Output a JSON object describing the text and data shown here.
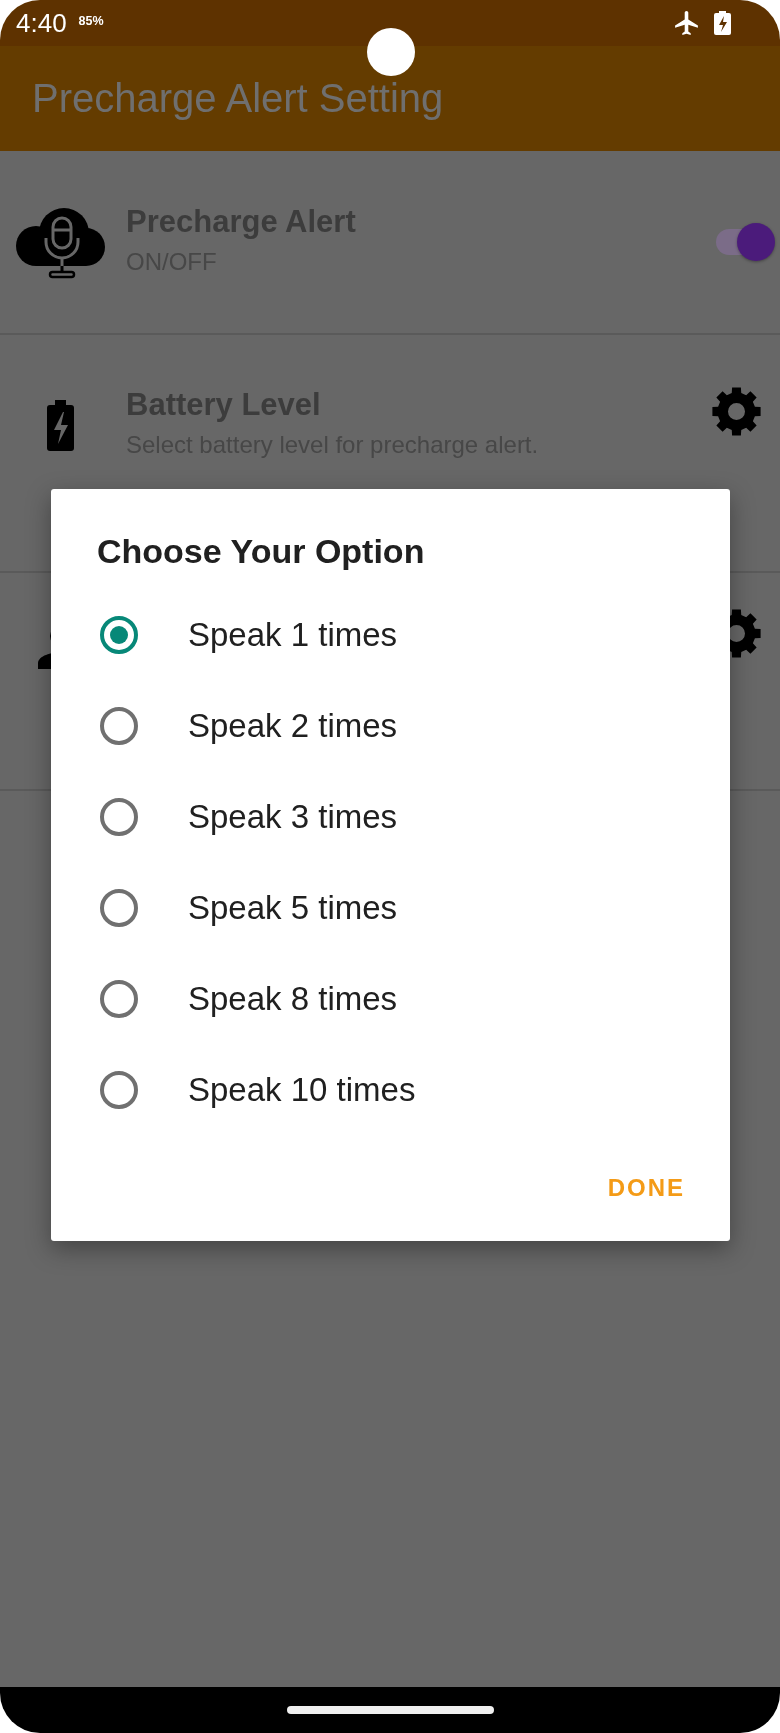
{
  "status_bar": {
    "time": "4:40",
    "battery_percent": "85%"
  },
  "app_bar": {
    "title": "Precharge Alert Setting"
  },
  "settings": [
    {
      "kind": "toggle",
      "title": "Precharge Alert",
      "subtitle": "ON/OFF",
      "on": true
    },
    {
      "kind": "action",
      "title": "Battery Level",
      "subtitle": "Select battery level for precharge alert."
    },
    {
      "kind": "action"
    }
  ],
  "dialog": {
    "title": "Choose Your Option",
    "options": [
      {
        "label": "Speak 1 times",
        "selected": true
      },
      {
        "label": "Speak 2 times",
        "selected": false
      },
      {
        "label": "Speak 3 times",
        "selected": false
      },
      {
        "label": "Speak 5 times",
        "selected": false
      },
      {
        "label": "Speak 8 times",
        "selected": false
      },
      {
        "label": "Speak 10 times",
        "selected": false
      }
    ],
    "button": "DONE"
  }
}
